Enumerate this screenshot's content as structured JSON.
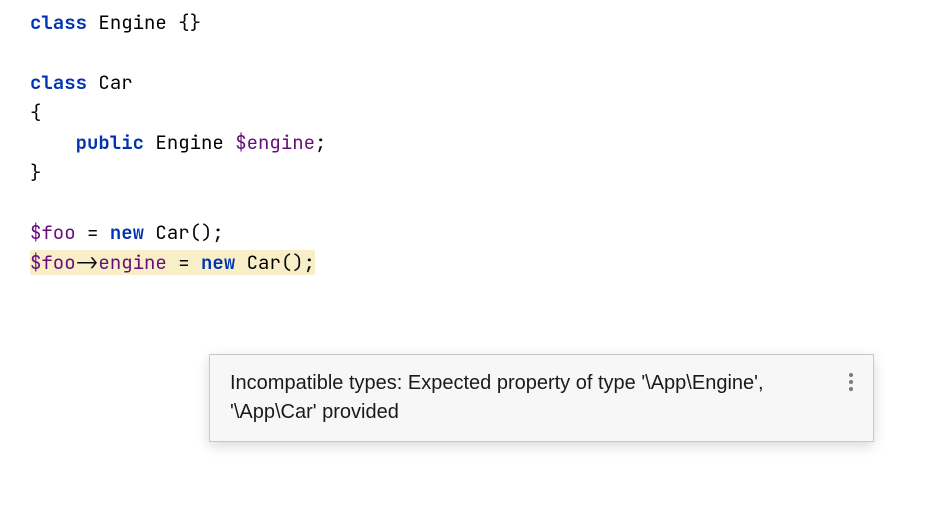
{
  "code": {
    "line1": {
      "kw_class": "class",
      "name_engine": "Engine",
      "braces": "{}"
    },
    "line3": {
      "kw_class": "class",
      "name_car": "Car"
    },
    "line4": {
      "brace_open": "{"
    },
    "line5": {
      "kw_public": "public",
      "type_engine": "Engine",
      "var_engine": "$engine",
      "semi": ";"
    },
    "line6": {
      "brace_close": "}"
    },
    "line8": {
      "var_foo": "$foo",
      "eq": " = ",
      "kw_new": "new",
      "type_car": "Car",
      "parens": "();"
    },
    "line9": {
      "var_foo": "$foo",
      "arrow": "->",
      "prop_engine": "engine",
      "eq": " = ",
      "kw_new": "new",
      "type_car": "Car",
      "parens": "();"
    }
  },
  "tooltip": {
    "message": "Incompatible types: Expected property of type '\\App\\Engine', '\\App\\Car' provided"
  }
}
